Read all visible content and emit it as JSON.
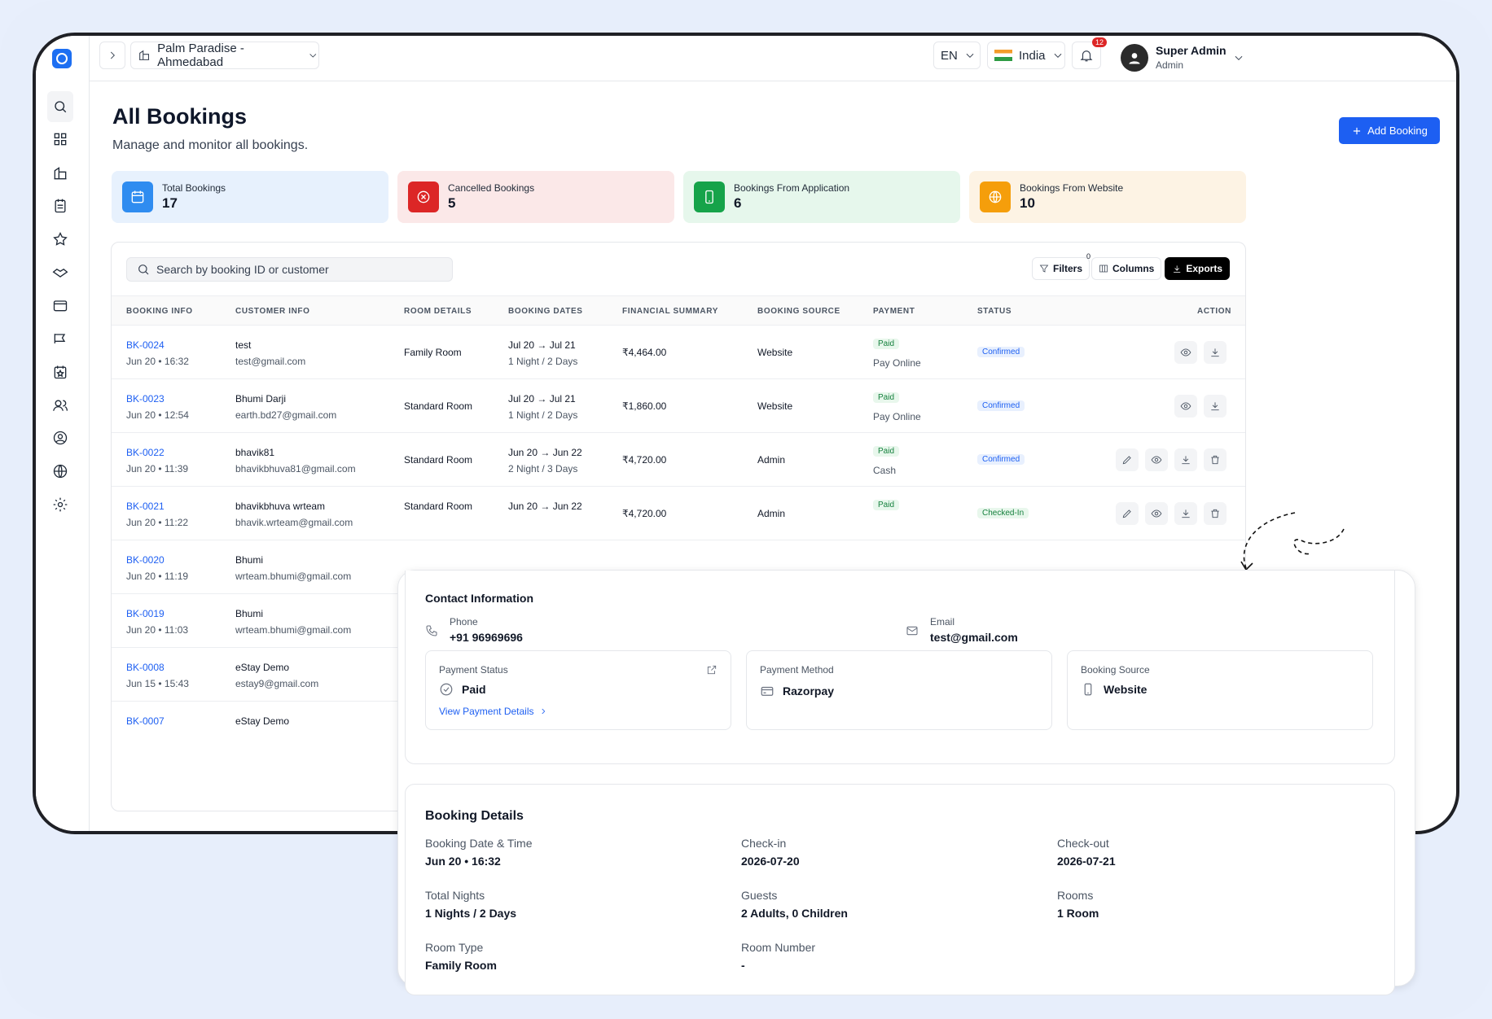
{
  "topbar": {
    "property": "Palm Paradise - Ahmedabad",
    "language": "EN",
    "country": "India",
    "notification_count": "12",
    "user_name": "Super Admin",
    "user_role": "Admin"
  },
  "page": {
    "title": "All Bookings",
    "subtitle": "Manage and monitor all bookings.",
    "add_button": "Add Booking"
  },
  "stats": [
    {
      "label": "Total Bookings",
      "value": "17",
      "color": "#2f8cf0",
      "bg": "#e7f1fd"
    },
    {
      "label": "Cancelled Bookings",
      "value": "5",
      "color": "#dc2626",
      "bg": "#fbe8e8"
    },
    {
      "label": "Bookings From Application",
      "value": "6",
      "color": "#16a34a",
      "bg": "#e6f7ec"
    },
    {
      "label": "Bookings From Website",
      "value": "10",
      "color": "#f59e0b",
      "bg": "#fdf3e4"
    }
  ],
  "toolbar": {
    "search_placeholder": "Search by booking ID or customer",
    "filters": "Filters",
    "filters_count": "0",
    "columns": "Columns",
    "exports": "Exports"
  },
  "columns": [
    "BOOKING INFO",
    "CUSTOMER INFO",
    "ROOM DETAILS",
    "BOOKING DATES",
    "FINANCIAL SUMMARY",
    "BOOKING SOURCE",
    "PAYMENT",
    "STATUS",
    "ACTION"
  ],
  "rows": [
    {
      "id": "BK-0024",
      "date": "Jun 20 • 16:32",
      "name": "test",
      "email": "test@gmail.com",
      "room": "Family Room",
      "dates": "Jul 20 → Jul 21",
      "nights": "1 Night / 2 Days",
      "amount": "₹4,464.00",
      "source": "Website",
      "payment": "Paid",
      "method": "Pay Online",
      "status": "Confirmed"
    },
    {
      "id": "BK-0023",
      "date": "Jun 20 • 12:54",
      "name": "Bhumi Darji",
      "email": "earth.bd27@gmail.com",
      "room": "Standard Room",
      "dates": "Jul 20 → Jul 21",
      "nights": "1 Night / 2 Days",
      "amount": "₹1,860.00",
      "source": "Website",
      "payment": "Paid",
      "method": "Pay Online",
      "status": "Confirmed"
    },
    {
      "id": "BK-0022",
      "date": "Jun 20 • 11:39",
      "name": "bhavik81",
      "email": "bhavikbhuva81@gmail.com",
      "room": "Standard Room",
      "dates": "Jun 20 → Jun 22",
      "nights": "2 Night / 3 Days",
      "amount": "₹4,720.00",
      "source": "Admin",
      "payment": "Paid",
      "method": "Cash",
      "status": "Confirmed"
    },
    {
      "id": "BK-0021",
      "date": "Jun 20 • 11:22",
      "name": "bhavikbhuva wrteam",
      "email": "bhavik.wrteam@gmail.com",
      "room": "Standard Room",
      "dates": "Jun 20 → Jun 22",
      "nights": "",
      "amount": "₹4,720.00",
      "source": "Admin",
      "payment": "Paid",
      "method": "",
      "status": "Checked-In"
    },
    {
      "id": "BK-0020",
      "date": "Jun 20 • 11:19",
      "name": "Bhumi",
      "email": "wrteam.bhumi@gmail.com"
    },
    {
      "id": "BK-0019",
      "date": "Jun 20 • 11:03",
      "name": "Bhumi",
      "email": "wrteam.bhumi@gmail.com"
    },
    {
      "id": "BK-0008",
      "date": "Jun 15 • 15:43",
      "name": "eStay Demo",
      "email": "estay9@gmail.com"
    },
    {
      "id": "BK-0007",
      "date": "",
      "name": "eStay Demo",
      "email": ""
    }
  ],
  "detail": {
    "contact_title": "Contact Information",
    "phone_label": "Phone",
    "phone": "+91 96969696",
    "email_label": "Email",
    "email": "test@gmail.com",
    "payment_status_label": "Payment Status",
    "payment_status": "Paid",
    "view_payment": "View Payment Details",
    "payment_method_label": "Payment Method",
    "payment_method": "Razorpay",
    "booking_source_label": "Booking Source",
    "booking_source": "Website",
    "booking_title": "Booking Details",
    "fields": [
      {
        "label": "Booking Date & Time",
        "value": "Jun 20 • 16:32"
      },
      {
        "label": "Check-in",
        "value": "2026-07-20"
      },
      {
        "label": "Check-out",
        "value": "2026-07-21"
      },
      {
        "label": "Total Nights",
        "value": "1 Nights / 2 Days"
      },
      {
        "label": "Guests",
        "value": "2 Adults, 0 Children"
      },
      {
        "label": "Rooms",
        "value": "1 Room"
      },
      {
        "label": "Room Type",
        "value": "Family Room"
      },
      {
        "label": "Room Number",
        "value": "-"
      }
    ]
  }
}
